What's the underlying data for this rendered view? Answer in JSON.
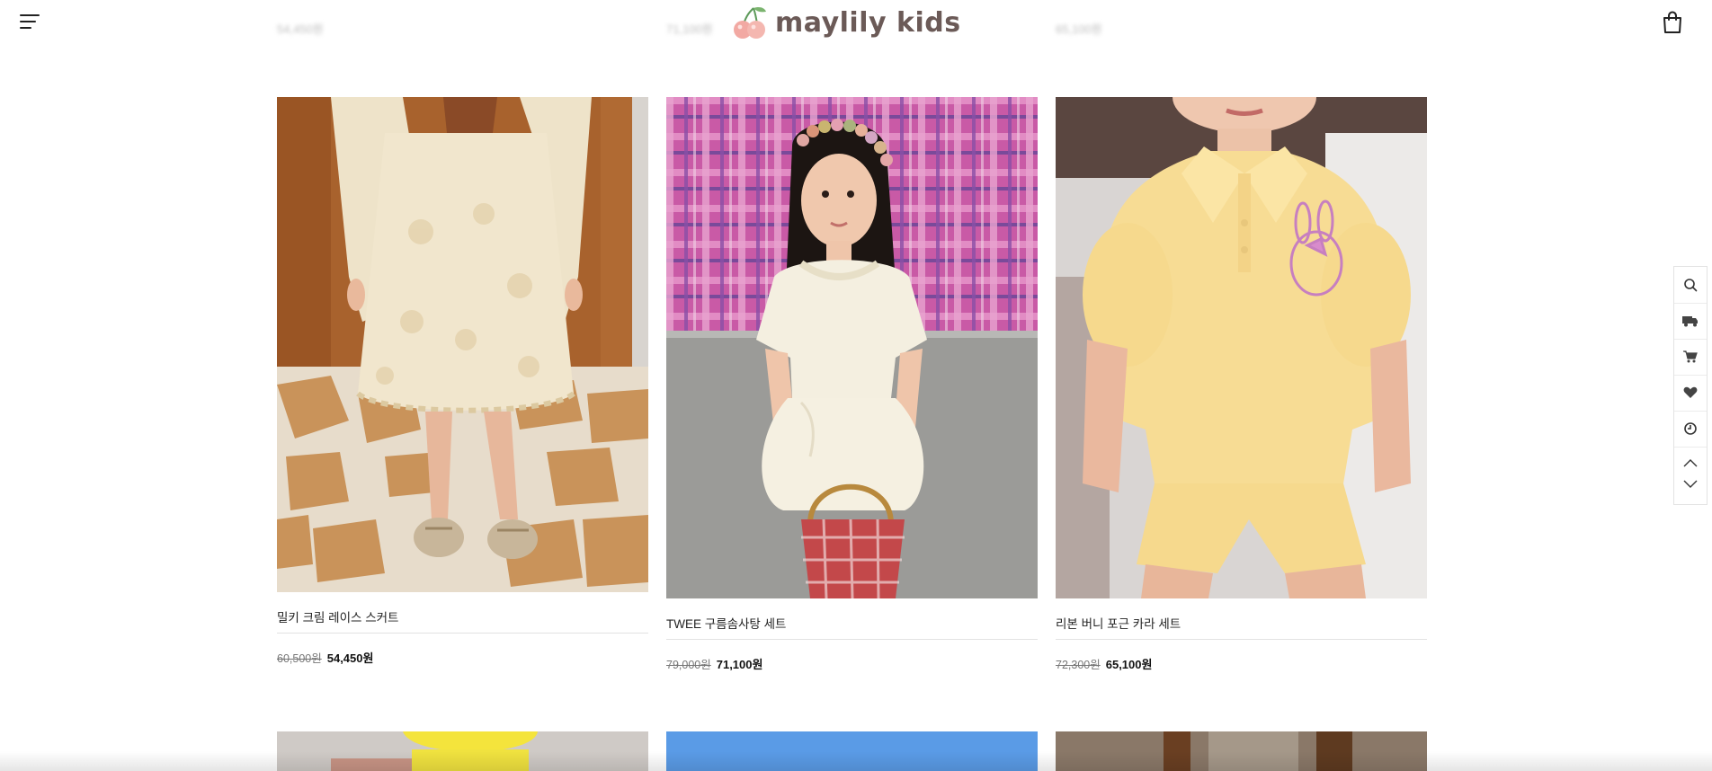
{
  "header": {
    "logo_text": "maylily kids",
    "menu_icon": "hamburger-menu-icon",
    "cart_icon": "shopping-bag-icon",
    "ghost_prices": [
      "54,450원",
      "71,100원",
      "65,100원"
    ]
  },
  "products": [
    {
      "name": "밀키 크림 레이스 스커트",
      "original_price": "60,500원",
      "sale_price": "54,450원",
      "image": "girl-in-cream-lace-skirt-photo"
    },
    {
      "name": "TWEE 구름솜사탕 세트",
      "original_price": "79,000원",
      "sale_price": "71,100원",
      "image": "girl-in-white-puff-set-with-basket-photo"
    },
    {
      "name": "리본 버니 포근 카라 세트",
      "original_price": "72,300원",
      "sale_price": "65,100원",
      "image": "girl-in-yellow-polo-set-photo"
    }
  ],
  "quickbar": {
    "items": [
      "search-icon",
      "delivery-truck-icon",
      "cart-icon",
      "heart-icon",
      "clock-icon"
    ],
    "scroll_up_icon": "chevron-up-icon",
    "scroll_down_icon": "chevron-down-icon"
  },
  "colors": {
    "logo_text": "#6b5a57",
    "logo_cherry": "#f2a9a3",
    "sale_price": "#111111",
    "original_price": "#777777"
  }
}
